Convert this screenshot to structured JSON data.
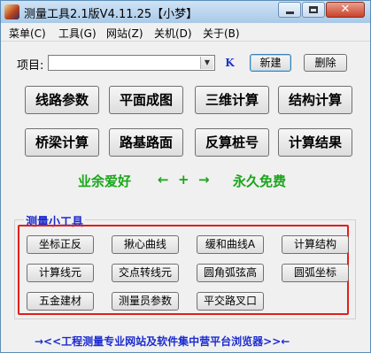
{
  "window": {
    "title": "测量工具2.1版V4.11.25【小梦】"
  },
  "menu": [
    {
      "label": "菜单(C)"
    },
    {
      "label": "工具(G)"
    },
    {
      "label": "网站(Z)"
    },
    {
      "label": "关机(D)"
    },
    {
      "label": "关于(B)"
    }
  ],
  "project": {
    "label": "项目:",
    "value": "",
    "k_label": "K",
    "new_label": "新建",
    "delete_label": "删除"
  },
  "main_buttons": [
    {
      "label": "线路参数"
    },
    {
      "label": "平面成图"
    },
    {
      "label": "三维计算"
    },
    {
      "label": "结构计算"
    },
    {
      "label": "桥梁计算"
    },
    {
      "label": "路基路面"
    },
    {
      "label": "反算桩号"
    },
    {
      "label": "计算结果"
    }
  ],
  "slogan": {
    "left": "业余爱好",
    "arrows": "←  +  →",
    "right": "永久免费"
  },
  "tools_group": {
    "title": "测量小工具",
    "buttons": [
      {
        "label": "坐标正反"
      },
      {
        "label": "揪心曲线"
      },
      {
        "label": "缓和曲线A"
      },
      {
        "label": "计算结构"
      },
      {
        "label": "计算线元"
      },
      {
        "label": "交点转线元"
      },
      {
        "label": "圆角弧弦高"
      },
      {
        "label": "圆弧坐标"
      },
      {
        "label": "五金建材"
      },
      {
        "label": "测量员参数"
      },
      {
        "label": "平交路叉口"
      }
    ]
  },
  "footer": {
    "link_text": "→<<工程测量专业网站及软件集中营平台浏览器>>←"
  },
  "colors": {
    "slogan": "#1aa51a",
    "group_title": "#1c2bd0",
    "highlight_border": "#e0201a",
    "footer_link": "#1c2bd0"
  }
}
